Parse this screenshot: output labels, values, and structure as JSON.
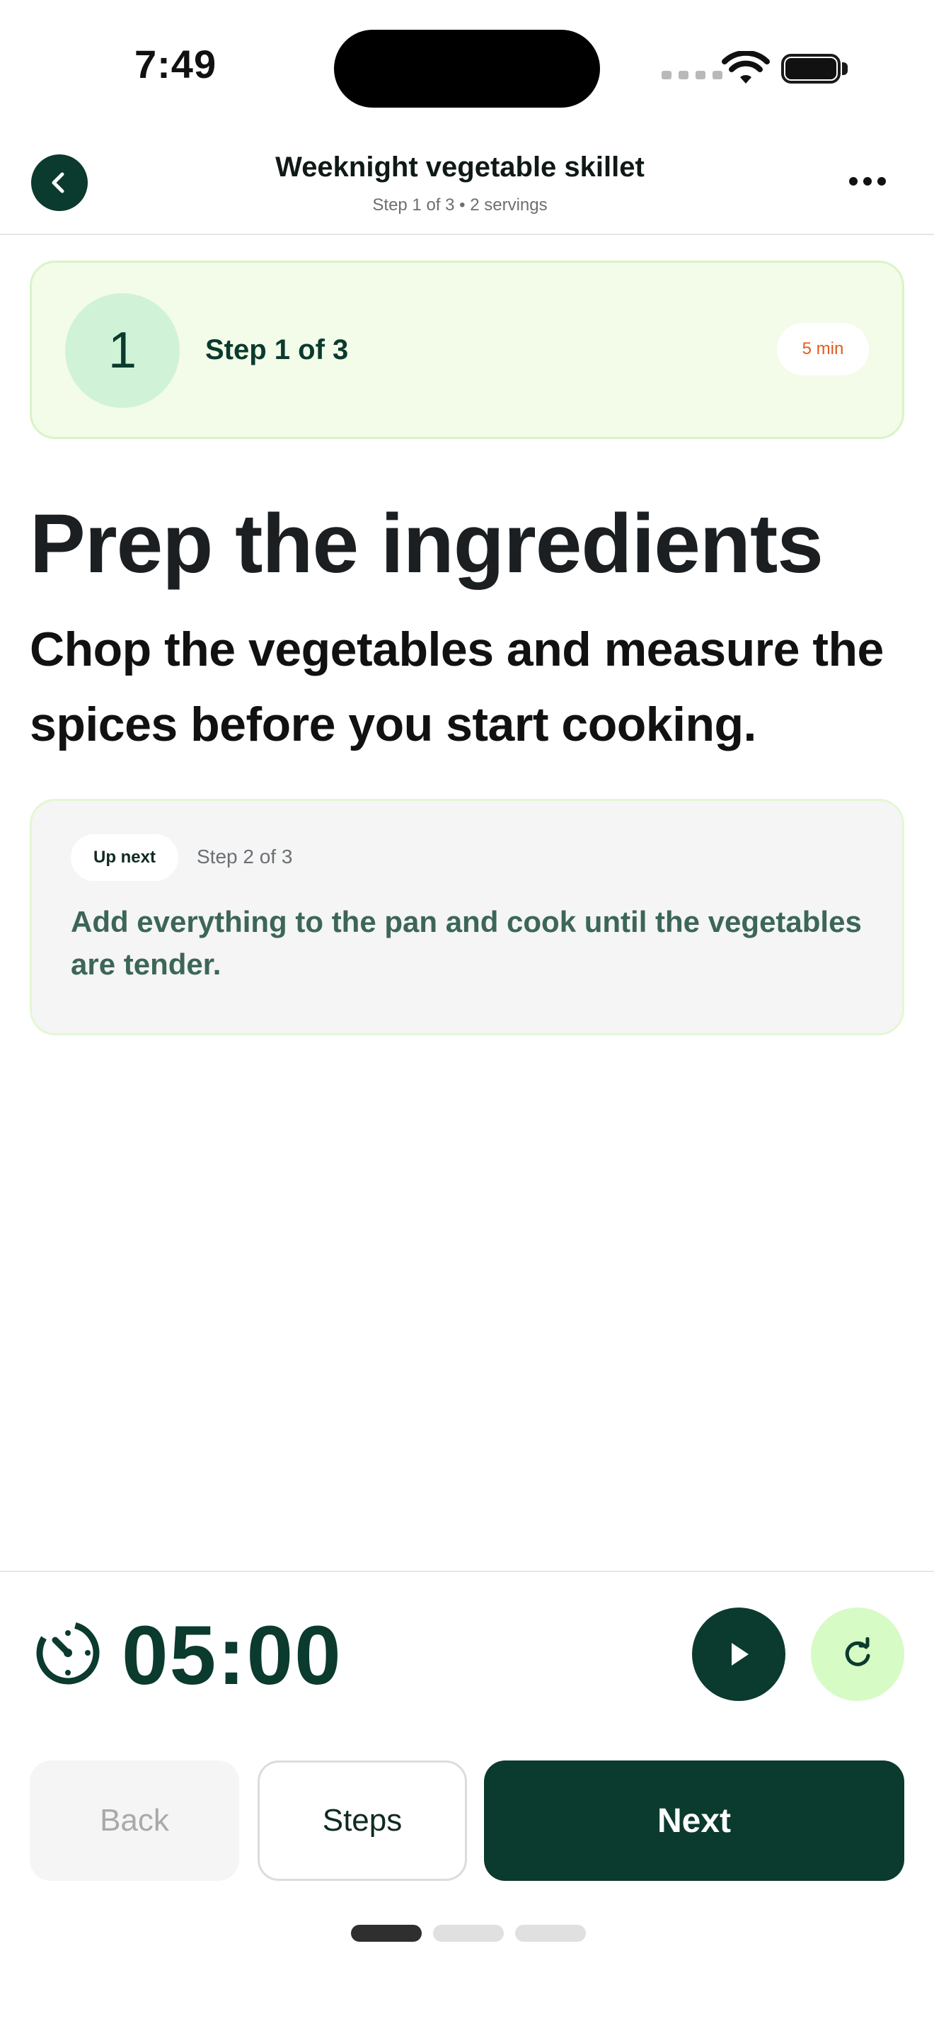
{
  "status_bar": {
    "time": "7:49"
  },
  "header": {
    "back_icon": "chevron-left-icon",
    "title": "Weeknight vegetable skillet",
    "subtitle": "Step 1 of 3 • 2 servings",
    "more_icon": "more-horizontal-icon"
  },
  "step_card": {
    "number": "1",
    "label": "Step 1 of 3",
    "duration": "5 min"
  },
  "main": {
    "title": "Prep the ingredients",
    "description": "Chop the vegetables and measure the spices before you start cooking."
  },
  "up_next": {
    "badge": "Up next",
    "step_label": "Step 2 of 3",
    "description": "Add everything to the pan and cook until the vegetables are tender."
  },
  "timer": {
    "value": "05:00",
    "icon": "timer-icon",
    "play_icon": "play-icon",
    "reset_icon": "refresh-icon"
  },
  "actions": {
    "back_label": "Back",
    "steps_label": "Steps",
    "next_label": "Next"
  },
  "progress": {
    "total_steps": 3,
    "current_step": 1
  },
  "colors": {
    "primary": "#0b3a2e",
    "accent_light": "#d7fbc4",
    "step_card_bg": "#f3fbe9",
    "duration_text": "#e35b1c"
  }
}
